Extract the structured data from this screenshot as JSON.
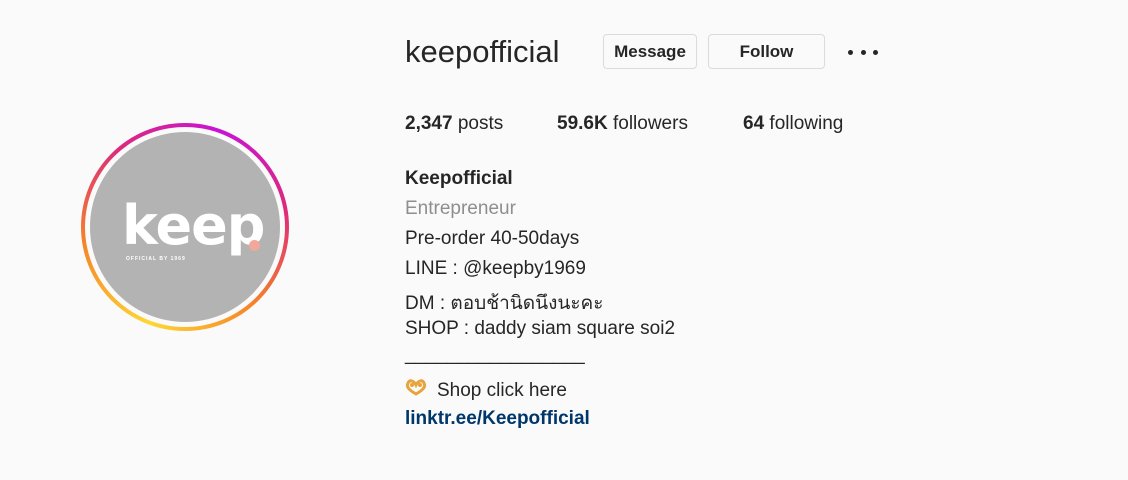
{
  "profile": {
    "username": "keepofficial",
    "message_label": "Message",
    "follow_label": "Follow",
    "avatar": {
      "logo_text": "keep",
      "logo_subtext": "OFFICIAL BY 1969",
      "ring_colors": [
        "#fdd835",
        "#f58529",
        "#dd2a7b",
        "#c813d6"
      ],
      "bg_color": "#b3b3b3",
      "dot_color": "#f1a799"
    }
  },
  "stats": {
    "posts_count": "2,347",
    "posts_label": "posts",
    "followers_count": "59.6K",
    "followers_label": "followers",
    "following_count": "64",
    "following_label": "following"
  },
  "bio": {
    "name": "Keepofficial",
    "category": "Entrepreneur",
    "lines": [
      "Pre-order 40-50days",
      "LINE : @keepby1969",
      "DM : ตอบช้านิดนึงนะคะ",
      "SHOP : daddy siam square soi2",
      "_________________"
    ],
    "shop_text": "Shop click here",
    "shop_icon": "pretzel-icon",
    "link": "linktr.ee/Keepofficial",
    "link_color": "#00376b"
  }
}
